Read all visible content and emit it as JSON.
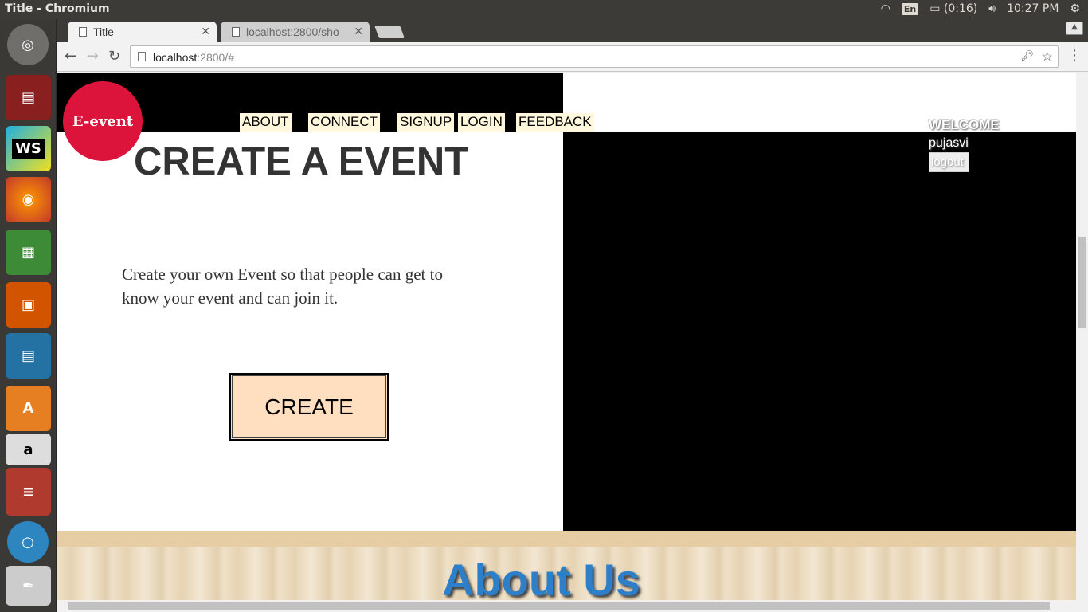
{
  "os": {
    "window_title": "Title - Chromium",
    "keyboard": "En",
    "battery": "(0:16)",
    "clock": "10:27 PM"
  },
  "launcher": {
    "items": [
      "ubuntu-dash",
      "files",
      "webstorm",
      "firefox",
      "libreoffice-calc",
      "libreoffice-impress",
      "libreoffice-writer",
      "software-center",
      "amazon",
      "app-stack",
      "chromium",
      "system-tools"
    ],
    "ws_label": "WS"
  },
  "browser": {
    "tabs": [
      {
        "title": "Title"
      },
      {
        "title": "localhost:2800/sho"
      }
    ],
    "url_host": "localhost",
    "url_path": ":2800/#"
  },
  "page": {
    "logo": "E-event",
    "nav": [
      "ABOUT",
      "CONNECT",
      "SIGNUP",
      "LOGIN",
      "FEEDBACK"
    ],
    "welcome": "WELCOME",
    "username": "pujasvi",
    "logout": "logout",
    "heading": "CREATE A EVENT",
    "description": "Create your own Event so that people can get to know your event and can join it.",
    "create_button": "CREATE",
    "about_heading": "About Us"
  },
  "colors": {
    "logo_bg": "#dc143c",
    "nav_bg": "#fff8dc",
    "create_bg": "#ffdfc0",
    "about_text": "#2e7fc9"
  }
}
